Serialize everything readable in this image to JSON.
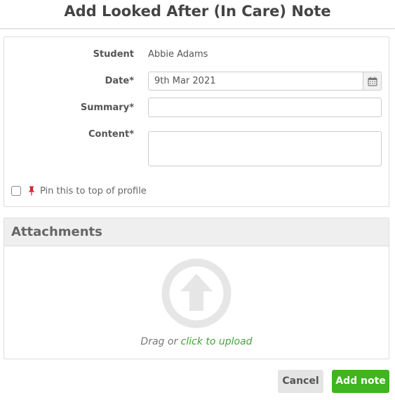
{
  "modal": {
    "title": "Add Looked After (In Care) Note"
  },
  "form": {
    "student_label": "Student",
    "student_value": "Abbie Adams",
    "date_label": "Date*",
    "date_value": "9th Mar 2021",
    "summary_label": "Summary*",
    "summary_value": "",
    "content_label": "Content*",
    "content_value": "",
    "pin_label": "Pin this to top of profile",
    "pin_checked": false
  },
  "attachments": {
    "header": "Attachments",
    "drag_text": "Drag or ",
    "upload_link": "click to upload"
  },
  "footer": {
    "cancel_label": "Cancel",
    "add_label": "Add note"
  },
  "colors": {
    "accent_green": "#3fb51f",
    "link_green": "#45a33a",
    "pin_red": "#d9232e"
  },
  "icons": {
    "date_picker": "calendar-icon",
    "pin": "pushpin-icon",
    "upload": "upload-arrow-icon"
  }
}
